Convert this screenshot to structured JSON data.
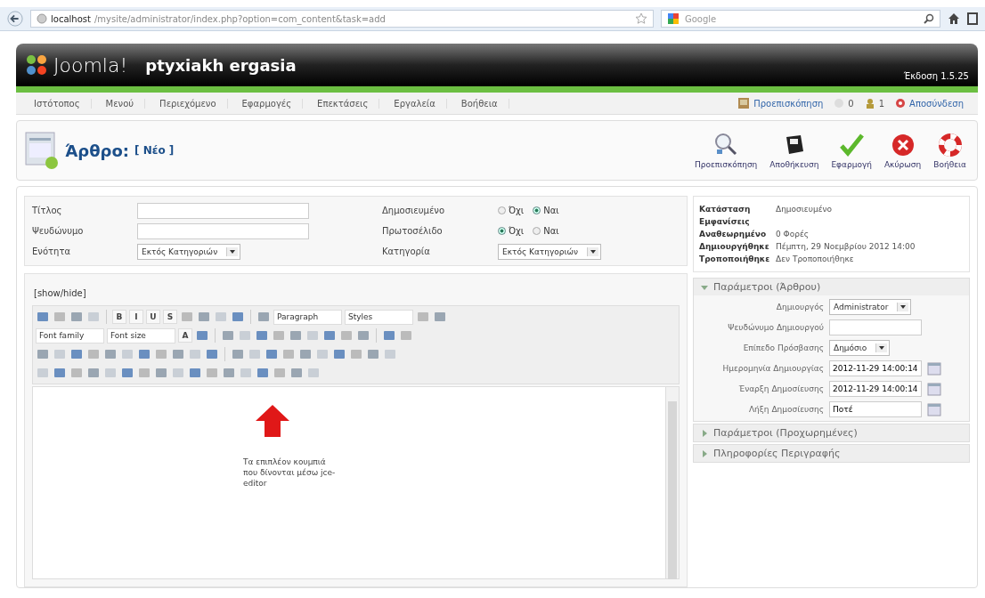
{
  "browser": {
    "url_host": "localhost",
    "url_path": "/mysite/administrator/index.php?option=com_content&task=add",
    "search_placeholder": "Google"
  },
  "header": {
    "logo": "Joomla!",
    "site_name": "ptyxiakh ergasia",
    "version": "Έκδοση 1.5.25"
  },
  "menu": [
    {
      "label": "Ιστότοπος"
    },
    {
      "label": "Μενού"
    },
    {
      "label": "Περιεχόμενο"
    },
    {
      "label": "Εφαρμογές"
    },
    {
      "label": "Επεκτάσεις"
    },
    {
      "label": "Εργαλεία"
    },
    {
      "label": "Βοήθεια"
    }
  ],
  "status": [
    {
      "kind": "preview",
      "text": "Προεπισκόπηση"
    },
    {
      "kind": "messages",
      "text": "0"
    },
    {
      "kind": "users",
      "text": "1"
    },
    {
      "kind": "logout",
      "text": "Αποσύνδεση"
    }
  ],
  "page_title": {
    "title": "Άρθρο:",
    "subtitle": "[ Νέο ]"
  },
  "toolbar": [
    {
      "kind": "preview",
      "label": "Προεπισκόπηση"
    },
    {
      "kind": "save",
      "label": "Αποθήκευση"
    },
    {
      "kind": "apply",
      "label": "Εφαρμογή"
    },
    {
      "kind": "cancel",
      "label": "Ακύρωση"
    },
    {
      "kind": "help",
      "label": "Βοήθεια"
    }
  ],
  "form_left": [
    {
      "label": "Τίτλος",
      "kind": "input"
    },
    {
      "label": "Ψευδώνυμο",
      "kind": "input"
    },
    {
      "label": "Ενότητα",
      "kind": "select",
      "value": "Εκτός Κατηγοριών"
    }
  ],
  "form_right": [
    {
      "label": "Δημοσιευμένο",
      "kind": "radio",
      "options": [
        {
          "label": "Όχι",
          "selected": false
        },
        {
          "label": "Ναι",
          "selected": true
        }
      ]
    },
    {
      "label": "Πρωτοσέλιδο",
      "kind": "radio",
      "options": [
        {
          "label": "Όχι",
          "selected": true
        },
        {
          "label": "Ναι",
          "selected": false
        }
      ]
    },
    {
      "label": "Κατηγορία",
      "kind": "select",
      "value": "Εκτός Κατηγοριών"
    }
  ],
  "editor": {
    "toggle_link": "[show/hide]",
    "toolbar_rows": [
      [
        {
          "kind": "icon"
        },
        {
          "kind": "icon"
        },
        {
          "kind": "icon"
        },
        {
          "kind": "icon"
        },
        {
          "kind": "sep"
        },
        {
          "kind": "glyph",
          "text": "B"
        },
        {
          "kind": "glyph",
          "text": "I"
        },
        {
          "kind": "glyph",
          "text": "U"
        },
        {
          "kind": "glyph",
          "text": "S"
        },
        {
          "kind": "icon"
        },
        {
          "kind": "icon"
        },
        {
          "kind": "icon"
        },
        {
          "kind": "icon"
        },
        {
          "kind": "sep"
        },
        {
          "kind": "icon"
        },
        {
          "kind": "select",
          "text": "Paragraph"
        },
        {
          "kind": "select",
          "text": "Styles"
        },
        {
          "kind": "icon"
        },
        {
          "kind": "icon"
        }
      ],
      [
        {
          "kind": "select",
          "text": "Font family"
        },
        {
          "kind": "select",
          "text": "Font size"
        },
        {
          "kind": "glyph",
          "text": "A"
        },
        {
          "kind": "icon"
        },
        {
          "kind": "sep"
        },
        {
          "kind": "icon"
        },
        {
          "kind": "icon"
        },
        {
          "kind": "icon"
        },
        {
          "kind": "icon"
        },
        {
          "kind": "icon"
        },
        {
          "kind": "icon"
        },
        {
          "kind": "icon"
        },
        {
          "kind": "icon"
        },
        {
          "kind": "icon"
        },
        {
          "kind": "sep"
        },
        {
          "kind": "icon"
        },
        {
          "kind": "icon"
        }
      ],
      [
        {
          "kind": "icon"
        },
        {
          "kind": "icon"
        },
        {
          "kind": "icon"
        },
        {
          "kind": "icon"
        },
        {
          "kind": "icon"
        },
        {
          "kind": "icon"
        },
        {
          "kind": "icon"
        },
        {
          "kind": "icon"
        },
        {
          "kind": "icon"
        },
        {
          "kind": "icon"
        },
        {
          "kind": "icon"
        },
        {
          "kind": "sep"
        },
        {
          "kind": "icon"
        },
        {
          "kind": "icon"
        },
        {
          "kind": "icon"
        },
        {
          "kind": "icon"
        },
        {
          "kind": "icon"
        },
        {
          "kind": "icon"
        },
        {
          "kind": "icon"
        },
        {
          "kind": "icon"
        },
        {
          "kind": "icon"
        },
        {
          "kind": "icon"
        }
      ],
      [
        {
          "kind": "icon"
        },
        {
          "kind": "icon"
        },
        {
          "kind": "icon"
        },
        {
          "kind": "icon"
        },
        {
          "kind": "icon"
        },
        {
          "kind": "icon"
        },
        {
          "kind": "icon"
        },
        {
          "kind": "icon"
        },
        {
          "kind": "icon"
        },
        {
          "kind": "icon"
        },
        {
          "kind": "icon"
        },
        {
          "kind": "icon"
        },
        {
          "kind": "icon"
        },
        {
          "kind": "icon"
        },
        {
          "kind": "icon"
        },
        {
          "kind": "icon"
        },
        {
          "kind": "icon"
        }
      ]
    ],
    "annotation": "Τα επιπλέον κουμπιά που δίνονται μέσω jce-editor"
  },
  "info": [
    {
      "label": "Κατάσταση",
      "value": "Δημοσιευμένο"
    },
    {
      "label": "Εμφανίσεις"
    },
    {
      "label": "Αναθεωρημένο",
      "value": "0 Φορές"
    },
    {
      "label": "Δημιουργήθηκε",
      "value": "Πέμπτη, 29 Νοεμβρίου 2012 14:00"
    },
    {
      "label": "Τροποποιήθηκε",
      "value": "Δεν Τροποποιήθηκε"
    }
  ],
  "panels": [
    {
      "title": "Παράμετροι (Άρθρου)",
      "expanded": true,
      "fields": [
        {
          "label": "Δημιουργός",
          "kind": "select",
          "value": "Administrator"
        },
        {
          "label": "Ψευδώνυμο Δημιουργού",
          "kind": "input"
        },
        {
          "label": "Επίπεδο Πρόσβασης",
          "kind": "select",
          "value": "Δημόσιο"
        },
        {
          "label": "Ημερομηνία Δημιουργίας",
          "kind": "date",
          "value": "2012-11-29 14:00:14"
        },
        {
          "label": "Έναρξη Δημοσίευσης",
          "kind": "date",
          "value": "2012-11-29 14:00:14"
        },
        {
          "label": "Λήξη Δημοσίευσης",
          "kind": "date",
          "value": "Ποτέ"
        }
      ]
    },
    {
      "title": "Παράμετροι (Προχωρημένες)",
      "expanded": false
    },
    {
      "title": "Πληροφορίες Περιγραφής",
      "expanded": false
    }
  ]
}
